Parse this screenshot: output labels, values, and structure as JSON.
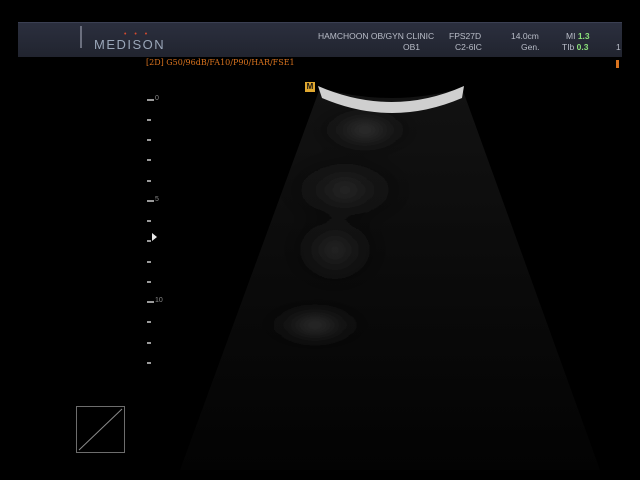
{
  "header": {
    "brand": "MEDISON",
    "brand_dots": "• • •",
    "clinic": "HAMCHOON OB/GYN CLINIC",
    "preset": "OB1",
    "fps": "FPS27D",
    "probe": "C2-6IC",
    "depth": "14.0cm",
    "frequency": "Gen.",
    "mi_label": "MI",
    "mi_value": "1.3",
    "tib_label": "TIb",
    "tib_value": "0.3",
    "right_edge": "1"
  },
  "mode_line": "[2D] G50/96dB/FA10/P90/HAR/FSE1",
  "marker": "M",
  "depth_scale": {
    "labels": [
      "0",
      "5",
      "10"
    ]
  },
  "colors": {
    "header_bg": "#262a37",
    "mode_text": "#d9731e",
    "marker": "#e0a830",
    "green_values": "#8be07a"
  }
}
